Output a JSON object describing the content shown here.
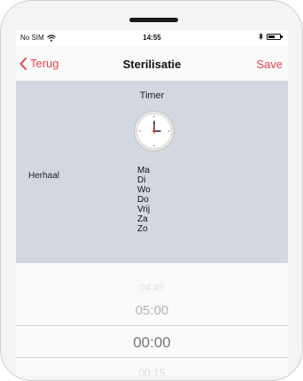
{
  "status": {
    "carrier": "No SIM",
    "time": "14:55"
  },
  "nav": {
    "back_label": "Terug",
    "title": "Sterilisatie",
    "save_label": "Save"
  },
  "timer": {
    "label": "Timer"
  },
  "repeat": {
    "label": "Herhaal",
    "days": [
      "Ma",
      "Di",
      "Wo",
      "Do",
      "Vrij",
      "Za",
      "Zo"
    ]
  },
  "picker": {
    "values": [
      "04:45",
      "05:00",
      "00:00",
      "00:15"
    ],
    "selected": "00:00"
  },
  "colors": {
    "accent": "#e2474a",
    "panel": "#d3d8e0"
  }
}
